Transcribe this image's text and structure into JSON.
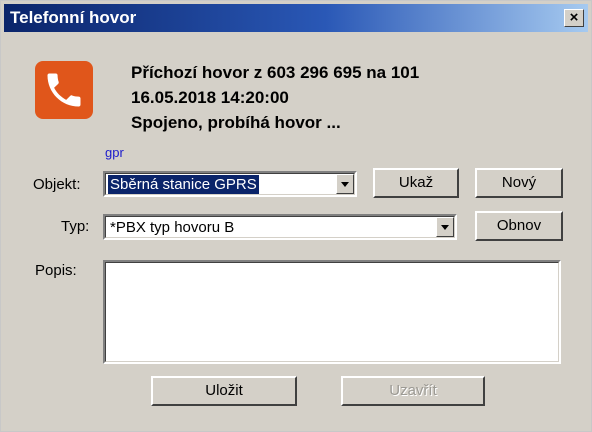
{
  "window": {
    "title": "Telefonní hovor",
    "close_label": "×"
  },
  "call": {
    "line1": "Příchozí hovor  z 603 296 695 na 101",
    "line2": "16.05.2018 14:20:00",
    "line3": "Spojeno, probíhá hovor ..."
  },
  "link_text": "gpr",
  "form": {
    "objekt_label": "Objekt:",
    "objekt_value": "Sběrná stanice GPRS",
    "typ_label": "Typ:",
    "typ_value": "*PBX typ hovoru B",
    "popis_label": "Popis:"
  },
  "buttons": {
    "ukaz": "Ukaž",
    "novy": "Nový",
    "obnov": "Obnov",
    "ulozit": "Uložit",
    "uzavrit": "Uzavřít"
  },
  "icons": {
    "phone": "phone-handset-icon",
    "dropdown": "chevron-down-icon"
  },
  "colors": {
    "title_bar": "#0a246a",
    "icon_bg": "#e0561b",
    "selection": "#0a246a",
    "link": "#1a1acc"
  }
}
